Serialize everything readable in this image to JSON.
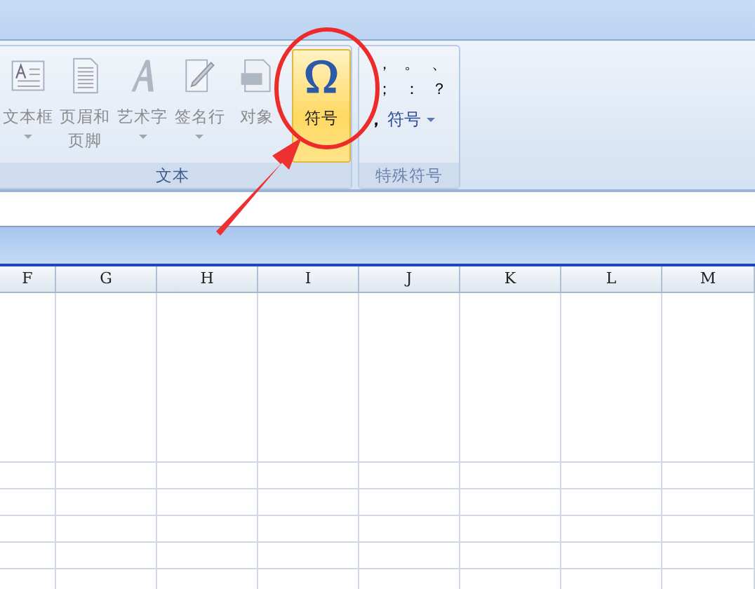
{
  "ribbon": {
    "groups": [
      {
        "label": "文本",
        "items": [
          {
            "kind": "textbox",
            "label": "文本框",
            "disabled": true,
            "dropdown": true
          },
          {
            "kind": "header",
            "label": "页眉和页脚",
            "disabled": true,
            "dropdown": false
          },
          {
            "kind": "wordart",
            "label": "艺术字",
            "disabled": true,
            "dropdown": true
          },
          {
            "kind": "signature",
            "label": "签名行",
            "disabled": true,
            "dropdown": true
          },
          {
            "kind": "object",
            "label": "对象",
            "disabled": true,
            "dropdown": false
          },
          {
            "kind": "symbol",
            "label": "符号",
            "disabled": false,
            "dropdown": false,
            "selected": true
          }
        ]
      },
      {
        "label": "特殊符号",
        "symbols": [
          "，",
          "。",
          "、",
          "；",
          "：",
          "？"
        ],
        "bullet": "，",
        "menu_label": "符号"
      }
    ]
  },
  "sheet": {
    "columns": [
      "F",
      "G",
      "H",
      "I",
      "J",
      "K",
      "L",
      "M"
    ]
  }
}
